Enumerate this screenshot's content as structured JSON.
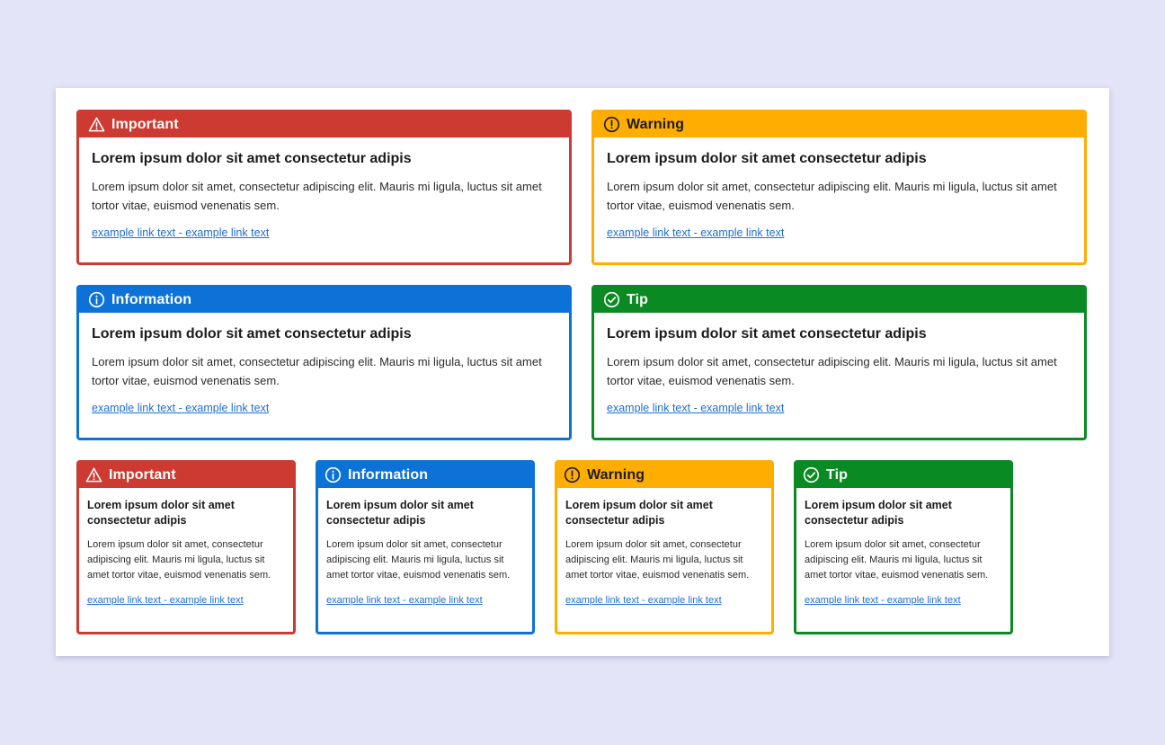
{
  "large_cards": [
    {
      "type": "important",
      "title": "Important",
      "icon": "warning-triangle-icon",
      "heading": "Lorem ipsum dolor sit amet consectetur adipis",
      "body": "Lorem ipsum dolor sit amet, consectetur adipiscing elit. Mauris mi ligula, luctus sit amet tortor vitae, euismod venenatis sem.",
      "link": "example link text - example link text",
      "color": "#cc3a31"
    },
    {
      "type": "warning",
      "title": "Warning",
      "icon": "exclamation-circle-icon",
      "heading": "Lorem ipsum dolor sit amet consectetur adipis",
      "body": "Lorem ipsum dolor sit amet, consectetur adipiscing elit. Mauris mi ligula, luctus sit amet tortor vitae, euismod venenatis sem.",
      "link": "example link text - example link text",
      "color": "#ffad00"
    },
    {
      "type": "information",
      "title": "Information",
      "icon": "info-circle-icon",
      "heading": "Lorem ipsum dolor sit amet consectetur adipis",
      "body": "Lorem ipsum dolor sit amet, consectetur adipiscing elit. Mauris mi ligula, luctus sit amet tortor vitae, euismod venenatis sem.",
      "link": "example link text - example link text",
      "color": "#0c72d8"
    },
    {
      "type": "tip",
      "title": "Tip",
      "icon": "check-circle-icon",
      "heading": "Lorem ipsum dolor sit amet consectetur adipis",
      "body": "Lorem ipsum dolor sit amet, consectetur adipiscing elit. Mauris mi ligula, luctus sit amet tortor vitae, euismod venenatis sem.",
      "link": "example link text - example link text",
      "color": "#0a8a23"
    }
  ],
  "small_cards": [
    {
      "type": "important",
      "title": "Important",
      "icon": "warning-triangle-icon",
      "heading": "Lorem ipsum dolor sit amet consectetur adipis",
      "body": "Lorem ipsum dolor sit amet, consectetur adipiscing elit. Mauris mi ligula, luctus sit amet tortor vitae, euismod venenatis sem.",
      "link": "example link text - example link text",
      "color": "#cc3a31"
    },
    {
      "type": "information",
      "title": "Information",
      "icon": "info-circle-icon",
      "heading": "Lorem ipsum dolor sit amet consectetur adipis",
      "body": "Lorem ipsum dolor sit amet, consectetur adipiscing elit. Mauris mi ligula, luctus sit amet tortor vitae, euismod venenatis sem.",
      "link": "example link text - example link text",
      "color": "#0c72d8"
    },
    {
      "type": "warning",
      "title": "Warning",
      "icon": "exclamation-circle-icon",
      "heading": "Lorem ipsum dolor sit amet consectetur adipis",
      "body": "Lorem ipsum dolor sit amet, consectetur adipiscing elit. Mauris mi ligula, luctus sit amet tortor vitae, euismod venenatis sem.",
      "link": "example link text - example link text",
      "color": "#ffad00"
    },
    {
      "type": "tip",
      "title": "Tip",
      "icon": "check-circle-icon",
      "heading": "Lorem ipsum dolor sit amet consectetur adipis",
      "body": "Lorem ipsum dolor sit amet, consectetur adipiscing elit. Mauris mi ligula, luctus sit amet tortor vitae, euismod venenatis sem.",
      "link": "example link text - example link text",
      "color": "#0a8a23"
    }
  ]
}
